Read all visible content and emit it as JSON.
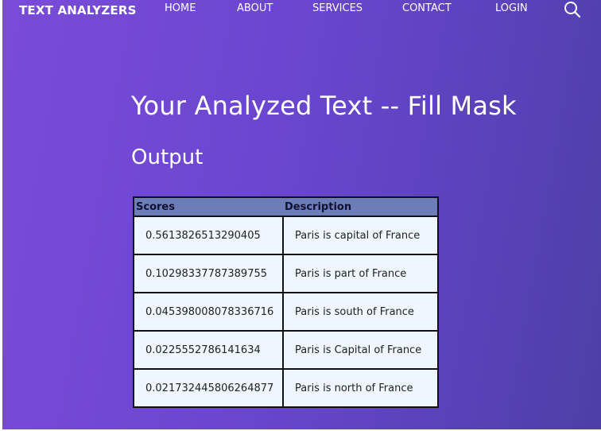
{
  "navbar": {
    "brand": "TEXT ANALYZERS",
    "links": [
      "HOME",
      "ABOUT",
      "SERVICES",
      "CONTACT",
      "LOGIN"
    ],
    "search_icon": "search-icon"
  },
  "main": {
    "title": "Your Analyzed Text -- Fill Mask",
    "section_title": "Output",
    "table": {
      "headers": [
        "Scores",
        "Description"
      ],
      "rows": [
        {
          "score": "0.5613826513290405",
          "description": "Paris is capital of France"
        },
        {
          "score": "0.10298337787389755",
          "description": "Paris is part of France"
        },
        {
          "score": "0.045398008078336716",
          "description": "Paris is south of France"
        },
        {
          "score": "0.0225552786141634",
          "description": "Paris is Capital of France"
        },
        {
          "score": "0.021732445806264877",
          "description": "Paris is north of France"
        }
      ]
    }
  },
  "colors": {
    "gradient_start": "#7a4bd9",
    "gradient_end": "#4d3fa6",
    "table_header_bg": "#6d7db8",
    "table_cell_bg": "#eef6ff"
  }
}
